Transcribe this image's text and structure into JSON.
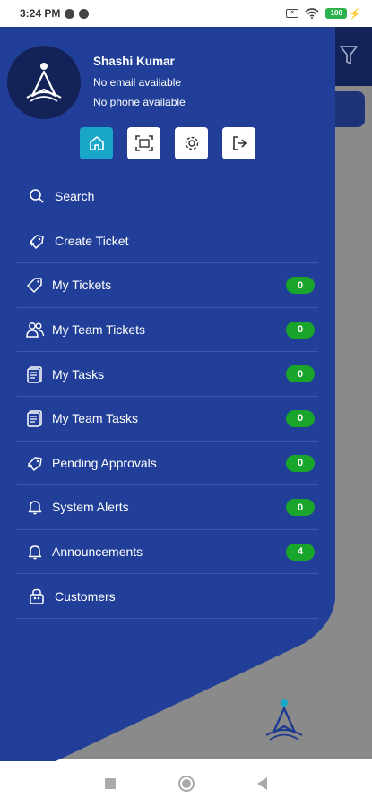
{
  "status_bar": {
    "time": "3:24 PM",
    "battery": "100"
  },
  "profile": {
    "name": "Shashi Kumar",
    "email": "No email available",
    "phone": "No phone available"
  },
  "quick_actions": [
    {
      "icon": "home-icon",
      "active": true
    },
    {
      "icon": "scan-icon",
      "active": false
    },
    {
      "icon": "settings-icon",
      "active": false
    },
    {
      "icon": "logout-icon",
      "active": false
    }
  ],
  "menu": {
    "items": [
      {
        "label": "Search",
        "icon": "search-icon"
      },
      {
        "label": "Create Ticket",
        "icon": "ticket-plus-icon"
      },
      {
        "label": "My Tickets",
        "icon": "tag-icon",
        "badge": "0"
      },
      {
        "label": "My Team Tickets",
        "icon": "team-icon",
        "badge": "0"
      },
      {
        "label": "My Tasks",
        "icon": "tasks-icon",
        "badge": "0"
      },
      {
        "label": "My Team Tasks",
        "icon": "team-tasks-icon",
        "badge": "0"
      },
      {
        "label": "Pending Approvals",
        "icon": "approval-icon",
        "badge": "0"
      },
      {
        "label": "System Alerts",
        "icon": "bell-icon",
        "badge": "0"
      },
      {
        "label": "Announcements",
        "icon": "bell-icon",
        "badge": "4"
      },
      {
        "label": "Customers",
        "icon": "customers-icon"
      }
    ]
  },
  "colors": {
    "drawer_blue": "#213f98",
    "badge_green": "#19a52b",
    "active_action": "#1aa6c9"
  }
}
